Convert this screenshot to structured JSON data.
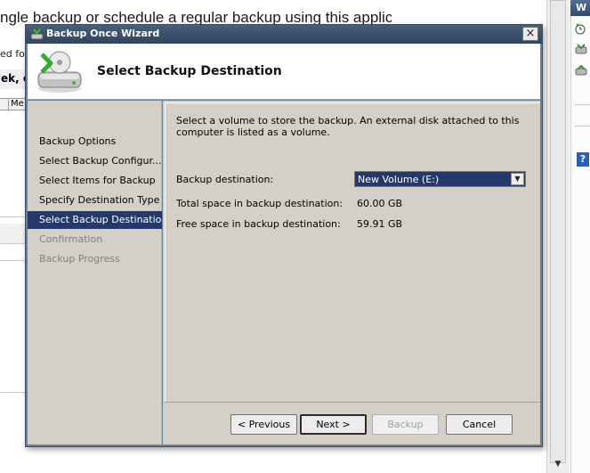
{
  "background_app": {
    "heading_fragment": "ngle backup or schedule a regular backup using this application.",
    "ed_for_fragment": "ed for",
    "bold_fragment": "ek, d",
    "column_fragment": "Me",
    "actions_header_fragment": "W",
    "help_glyph": "?",
    "scroll_arrow": "▼"
  },
  "dialog": {
    "title": "Backup Once Wizard",
    "close_glyph": "×",
    "page_title": "Select Backup Destination",
    "nav_items": [
      {
        "label": "Backup Options",
        "state": "normal"
      },
      {
        "label": "Select Backup Configur...",
        "state": "normal"
      },
      {
        "label": "Select Items for Backup",
        "state": "normal"
      },
      {
        "label": "Specify Destination Type",
        "state": "normal"
      },
      {
        "label": "Select Backup Destination",
        "state": "active"
      },
      {
        "label": "Confirmation",
        "state": "disabled"
      },
      {
        "label": "Backup Progress",
        "state": "disabled"
      }
    ],
    "description": "Select a volume to store the backup. An external disk attached to this computer is listed as a volume.",
    "fields": {
      "destination_label": "Backup destination:",
      "destination_value": "New Volume (E:)",
      "destination_arrow": "▼",
      "total_label": "Total space in backup destination:",
      "total_value": "60.00 GB",
      "free_label": "Free space in backup destination:",
      "free_value": "59.91 GB"
    },
    "buttons": {
      "previous": "< Previous",
      "next": "Next >",
      "backup": "Backup",
      "cancel": "Cancel"
    }
  },
  "colors": {
    "title_bar": "#2f4560",
    "selection": "#24386a",
    "panel": "#d4d0c8"
  }
}
